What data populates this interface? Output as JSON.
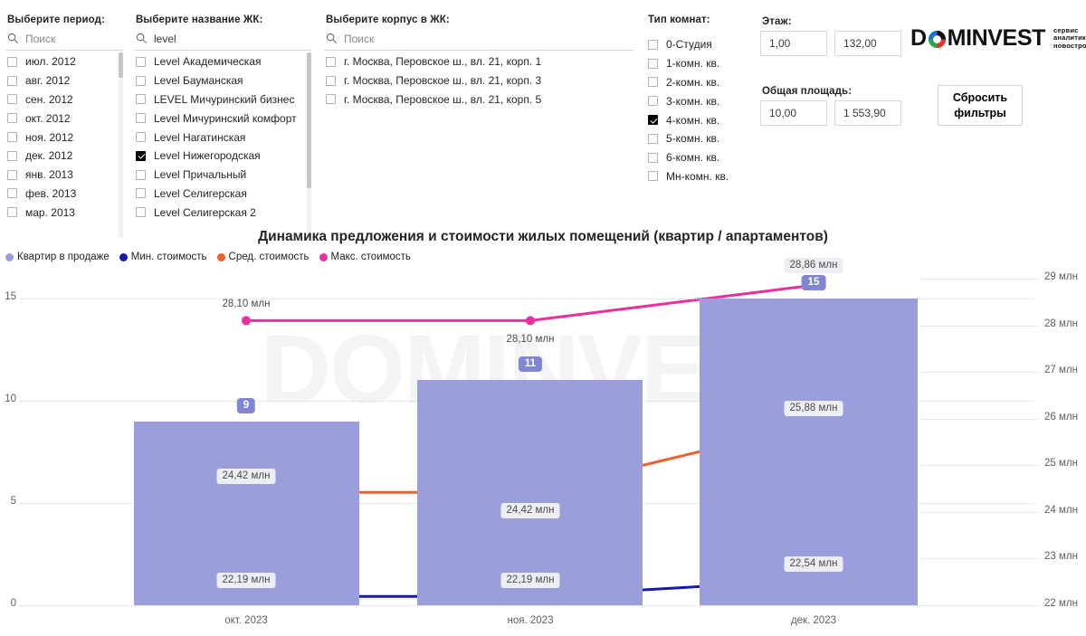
{
  "filters": {
    "period": {
      "title": "Выберите период:",
      "search_placeholder": "Поиск",
      "search_value": "",
      "items": [
        {
          "label": "июл. 2012",
          "checked": false
        },
        {
          "label": "авг. 2012",
          "checked": false
        },
        {
          "label": "сен. 2012",
          "checked": false
        },
        {
          "label": "окт. 2012",
          "checked": false
        },
        {
          "label": "ноя. 2012",
          "checked": false
        },
        {
          "label": "дек. 2012",
          "checked": false
        },
        {
          "label": "янв. 2013",
          "checked": false
        },
        {
          "label": "фев. 2013",
          "checked": false
        },
        {
          "label": "мар. 2013",
          "checked": false
        }
      ]
    },
    "complex": {
      "title": "Выберите название ЖК:",
      "search_placeholder": "Поиск",
      "search_value": "level",
      "items": [
        {
          "label": "Level Академическая",
          "checked": false
        },
        {
          "label": "Level Бауманская",
          "checked": false
        },
        {
          "label": "LEVEL Мичуринский бизнес",
          "checked": false
        },
        {
          "label": "Level Мичуринский комфорт",
          "checked": false
        },
        {
          "label": "Level Нагатинская",
          "checked": false
        },
        {
          "label": "Level Нижегородская",
          "checked": true
        },
        {
          "label": "Level Причальный",
          "checked": false
        },
        {
          "label": "Level Селигерская",
          "checked": false
        },
        {
          "label": "Level Селигерская 2",
          "checked": false
        }
      ]
    },
    "building": {
      "title": "Выберите корпус в ЖК:",
      "search_placeholder": "Поиск",
      "search_value": "",
      "items": [
        {
          "label": "г. Москва, Перовское ш., вл. 21, корп. 1",
          "checked": false
        },
        {
          "label": "г. Москва, Перовское ш., вл. 21, корп. 3",
          "checked": false
        },
        {
          "label": "г. Москва, Перовское ш., вл. 21, корп. 5",
          "checked": false
        }
      ]
    },
    "rooms": {
      "title": "Тип комнат:",
      "items": [
        {
          "label": "0-Студия",
          "checked": false
        },
        {
          "label": "1-комн. кв.",
          "checked": false
        },
        {
          "label": "2-комн. кв.",
          "checked": false
        },
        {
          "label": "3-комн. кв.",
          "checked": false
        },
        {
          "label": "4-комн. кв.",
          "checked": true
        },
        {
          "label": "5-комн. кв.",
          "checked": false
        },
        {
          "label": "6-комн. кв.",
          "checked": false
        },
        {
          "label": "Мн-комн. кв.",
          "checked": false
        }
      ]
    },
    "floor": {
      "title": "Этаж:",
      "min": "1,00",
      "max": "132,00"
    },
    "area": {
      "title": "Общая площадь:",
      "min": "10,00",
      "max": "1 553,90"
    },
    "reset_button": {
      "line1": "Сбросить",
      "line2": "фильтры"
    }
  },
  "brand": {
    "name_part1": "D",
    "name_o": "O",
    "name_part2": "MINVEST",
    "tagline_line1": "сервис",
    "tagline_line2": "аналитики",
    "tagline_line3": "новостроек",
    "watermark": "DOMINVEST"
  },
  "chart_data": {
    "type": "bar",
    "title": "Динамика предложения и стоимости жилых помещений (квартир / апартаментов)",
    "categories": [
      "окт. 2023",
      "ноя. 2023",
      "дек. 2023"
    ],
    "xlabel": "",
    "ylabel": "",
    "grid": true,
    "legend_position": "top-left",
    "legend": [
      "Квартир в продаже",
      "Мин. стоимость",
      "Сред. стоимость",
      "Макс. стоимость"
    ],
    "left_axis": {
      "ticks": [
        "0",
        "5",
        "10",
        "15"
      ],
      "ylim": [
        0,
        16.5
      ]
    },
    "right_axis": {
      "ticks": [
        "22 млн",
        "23 млн",
        "24 млн",
        "25 млн",
        "26 млн",
        "27 млн",
        "28 млн",
        "29 млн"
      ],
      "ylim": [
        22,
        29
      ]
    },
    "series": [
      {
        "name": "Квартир в продаже",
        "type": "bar",
        "axis": "left",
        "color": "#9a9fdb",
        "values": [
          9,
          11,
          15
        ],
        "labels": [
          "9",
          "11",
          "15"
        ]
      },
      {
        "name": "Мин. стоимость",
        "type": "line",
        "axis": "right",
        "color": "#1a1aa6",
        "values": [
          22.19,
          22.19,
          22.54
        ],
        "labels": [
          "22,19 млн",
          "22,19 млн",
          "22,54 млн"
        ]
      },
      {
        "name": "Сред. стоимость",
        "type": "line",
        "axis": "right",
        "color": "#e8622a",
        "values": [
          24.42,
          24.42,
          25.88
        ],
        "labels": [
          "24,42 млн",
          "24,42 млн",
          "25,88 млн"
        ]
      },
      {
        "name": "Макс. стоимость",
        "type": "line",
        "axis": "right",
        "color": "#ec2fa0",
        "values": [
          28.1,
          28.1,
          28.86
        ],
        "labels": [
          "28,10 млн",
          "28,10 млн",
          "28,86 млн"
        ]
      }
    ]
  }
}
